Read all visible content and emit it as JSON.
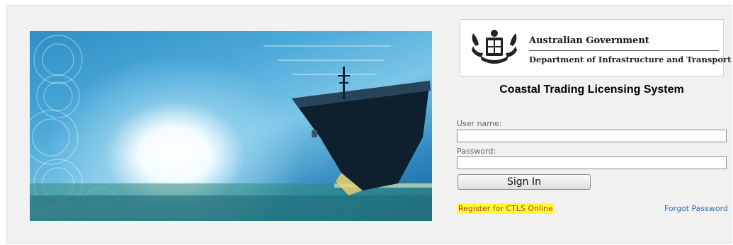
{
  "banner": {
    "image_name": "ship-banner-image"
  },
  "header": {
    "gov_name": "Australian Government",
    "department": "Department of Infrastructure and Transport",
    "crest_icon": "coat-of-arms-icon"
  },
  "login": {
    "system_title": "Coastal Trading Licensing System",
    "username_label": "User name:",
    "username_value": "",
    "password_label": "Password:",
    "password_value": "",
    "sign_in_label": "Sign In",
    "register_link": "Register for CTLS Online",
    "forgot_link": "Forgot Password"
  },
  "colors": {
    "register_highlight": "#ffff33",
    "register_text": "#c0392b",
    "link_blue": "#2a6db8",
    "background": "#f1f1f1"
  }
}
